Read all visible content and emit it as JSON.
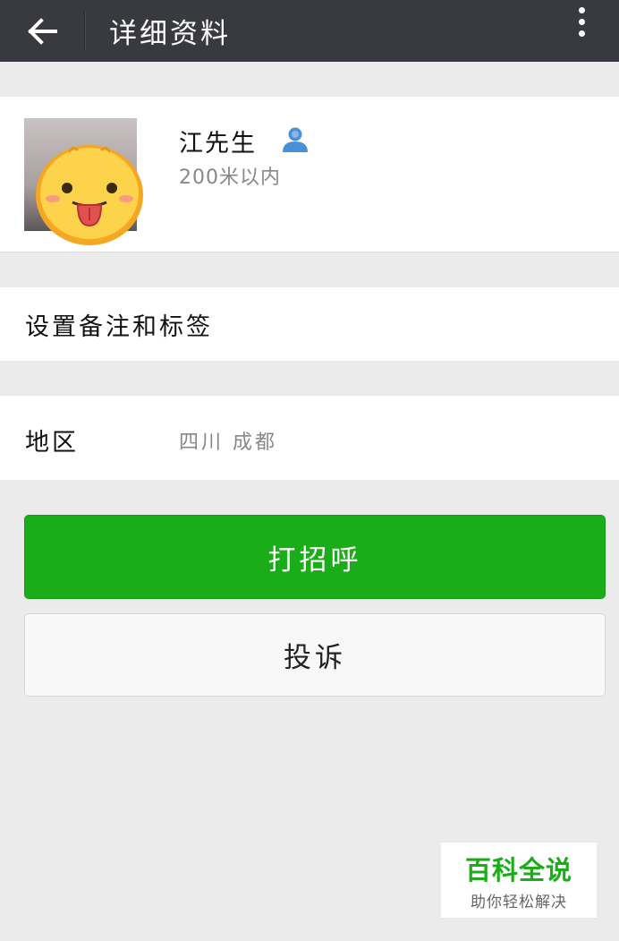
{
  "header": {
    "title": "详细资料",
    "back_icon": "arrow-left-icon",
    "more_icon": "more-vertical-icon"
  },
  "profile": {
    "name": "江先生",
    "badge_icon": "person-icon",
    "distance": "200米以内",
    "avatar_icon": "tongue-out-emoji-icon"
  },
  "remark": {
    "label": "设置备注和标签"
  },
  "region": {
    "label": "地区",
    "value": "四川  成都"
  },
  "actions": {
    "greet_label": "打招呼",
    "report_label": "投诉"
  },
  "watermark": {
    "main": "百科全说",
    "sub": "助你轻松解决"
  },
  "colors": {
    "titlebar": "#393a3f",
    "accent_green": "#1aad19",
    "background": "#ebebeb",
    "badge_blue": "#4a90d9"
  }
}
